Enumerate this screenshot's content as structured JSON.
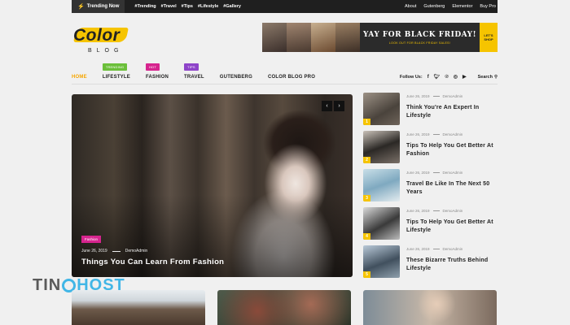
{
  "topbar": {
    "trending_label": "Trending Now",
    "tags": [
      "#Trending",
      "#Travel",
      "#Tips",
      "#Lifestyle",
      "#Gallery"
    ],
    "links": [
      "About",
      "Gutenberg",
      "Elementor",
      "Buy Pro"
    ]
  },
  "logo": {
    "word1": "Color",
    "word2": "BLOG"
  },
  "banner": {
    "headline": "YAY FOR BLACK FRIDAY!",
    "subline": "LOOK OUT FOR BLACK FRIDAY SALES!",
    "cta": "LET'S SHOP"
  },
  "nav": {
    "items": [
      {
        "label": "HOME",
        "badge": ""
      },
      {
        "label": "LIFESTYLE",
        "badge": "TRENDING"
      },
      {
        "label": "FASHION",
        "badge": "HOT"
      },
      {
        "label": "TRAVEL",
        "badge": "TIPS"
      },
      {
        "label": "GUTENBERG",
        "badge": ""
      },
      {
        "label": "COLOR BLOG PRO",
        "badge": ""
      }
    ],
    "badge_colors": {
      "TRENDING": "#6bbf3a",
      "HOT": "#d6248e",
      "TIPS": "#8e44c9"
    },
    "follow_label": "Follow Us:",
    "social_icons": [
      "facebook-icon",
      "twitter-icon",
      "pinterest-icon",
      "instagram-icon",
      "youtube-icon"
    ],
    "search_label": "Search"
  },
  "hero": {
    "category": "Fashion",
    "date": "June 26, 2019",
    "author": "DemoAdmin",
    "title": "Things You Can Learn From Fashion"
  },
  "side_posts": [
    {
      "num": "1",
      "date": "June 26, 2019",
      "author": "DemoAdmin",
      "title": "Think You're An Expert In Lifestyle"
    },
    {
      "num": "2",
      "date": "June 26, 2019",
      "author": "DemoAdmin",
      "title": "Tips To Help You Get Better At Fashion"
    },
    {
      "num": "3",
      "date": "June 26, 2019",
      "author": "DemoAdmin",
      "title": "Travel Be Like In The Next 50 Years"
    },
    {
      "num": "4",
      "date": "June 26, 2019",
      "author": "DemoAdmin",
      "title": "Tips To Help You Get Better At Lifestyle"
    },
    {
      "num": "5",
      "date": "June 26, 2019",
      "author": "DemoAdmin",
      "title": "These Bizarre Truths Behind Lifestyle"
    }
  ],
  "watermark": {
    "part1": "TIN",
    "part2": "HOST"
  },
  "colors": {
    "accent": "#f6c400",
    "category": "#d6248e",
    "dark": "#1f1f1f"
  }
}
